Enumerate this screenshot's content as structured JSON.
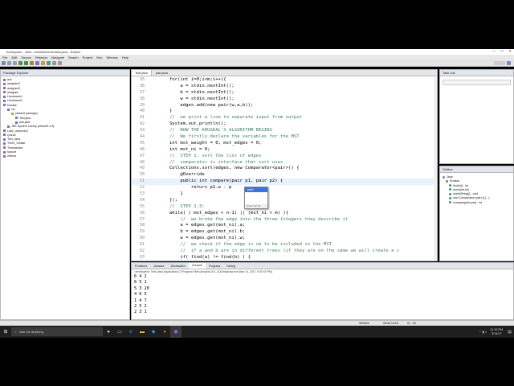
{
  "window": {
    "title": "workspace - Java - kruskal/src/kruskal.java - Eclipse"
  },
  "menu": [
    "File",
    "Edit",
    "Source",
    "Refactor",
    "Navigate",
    "Search",
    "Project",
    "Run",
    "Window",
    "Help"
  ],
  "package_explorer": {
    "title": "Package Explorer",
    "items": [
      {
        "label": "ack",
        "indent": 0
      },
      {
        "label": "anagram2",
        "indent": 0
      },
      {
        "label": "anagram3",
        "indent": 0
      },
      {
        "label": "anagram",
        "indent": 0
      },
      {
        "label": "Homework1",
        "indent": 0
      },
      {
        "label": "Homework2",
        "indent": 0
      },
      {
        "label": "kruskal",
        "indent": 0
      },
      {
        "label": "src",
        "indent": 1
      },
      {
        "label": "(default package)",
        "indent": 2
      },
      {
        "label": "Test.java",
        "indent": 3
      },
      {
        "label": "pair.java",
        "indent": 3
      },
      {
        "label": "JRE System Library [JavaSE-1.8]",
        "indent": 1
      },
      {
        "label": "Lab2_observer2",
        "indent": 0
      },
      {
        "label": "Queue",
        "indent": 0
      },
      {
        "label": "Test_Java",
        "indent": 0
      },
      {
        "label": "Three_Similar",
        "indent": 0
      },
      {
        "label": "Threadmark",
        "indent": 0
      },
      {
        "label": "topsort",
        "indent": 0
      },
      {
        "label": "whinos",
        "indent": 0
      }
    ]
  },
  "editor": {
    "tabs": [
      "Test.java",
      "pair.java"
    ],
    "lines": [
      {
        "n": "35",
        "text": "        for(int i=0;i<m;i++){",
        "kind": "code"
      },
      {
        "n": "36",
        "text": "            a = stdin.nextInt();",
        "kind": "code"
      },
      {
        "n": "37",
        "text": "            b = stdin.nextInt();",
        "kind": "code"
      },
      {
        "n": "38",
        "text": "            w = stdin.nextInt();",
        "kind": "code"
      },
      {
        "n": "39",
        "text": "            edges.add(new pair(w,a,b));",
        "kind": "code"
      },
      {
        "n": "40",
        "text": "        }",
        "kind": "code"
      },
      {
        "n": "41",
        "text": "        //  we print a line to separate input from output",
        "kind": "comment"
      },
      {
        "n": "42",
        "text": "        System.out.println();",
        "kind": "code"
      },
      {
        "n": "43",
        "text": "        //  NOW THE KRUSKAL'S ALGORITHM BEGINS",
        "kind": "comment"
      },
      {
        "n": "44",
        "text": "        //  We firstly declare the variables for the MST",
        "kind": "comment"
      },
      {
        "n": "45",
        "text": "        int mst_weight = 0, mst_edges = 0;",
        "kind": "code"
      },
      {
        "n": "46",
        "text": "        int mst_ni = 0;",
        "kind": "code"
      },
      {
        "n": "47",
        "text": "        //  STEP 1: sort the list of edges",
        "kind": "comment"
      },
      {
        "n": "48",
        "text": "        //  comparator is interface that sort uses",
        "kind": "comment"
      },
      {
        "n": "49",
        "text": "        Collections.sort(edges, new Comparator<pair>() {",
        "kind": "code"
      },
      {
        "n": "50",
        "text": "            @Override",
        "kind": "code"
      },
      {
        "n": "51",
        "text": "            public int compare(pair p1, pair p2) {",
        "kind": "hl"
      },
      {
        "n": "52",
        "text": "                return p1.w - p",
        "kind": "code"
      },
      {
        "n": "53",
        "text": "            }",
        "kind": "code"
      },
      {
        "n": "54",
        "text": "        });",
        "kind": "code"
      },
      {
        "n": "55",
        "text": "        //  STEP 2-3:",
        "kind": "comment"
      },
      {
        "n": "56",
        "text": "        while( ( mst_edges < n-1) || (mst_ni < m) ){",
        "kind": "code"
      },
      {
        "n": "57",
        "text": "            //  we broke the edge into the three integers they describe it",
        "kind": "comment"
      },
      {
        "n": "58",
        "text": "            a = edges.get(mst_ni).a;",
        "kind": "code"
      },
      {
        "n": "59",
        "text": "            b = edges.get(mst_ni).b;",
        "kind": "code"
      },
      {
        "n": "60",
        "text": "            w = edges.get(mst_ni).w;",
        "kind": "code"
      },
      {
        "n": "61",
        "text": "            //  we check if the edge is ok to be included in the MST",
        "kind": "comment"
      },
      {
        "n": "62",
        "text": "            //  if a and b are in different trees (if they are on the same we will create a c",
        "kind": "comment"
      },
      {
        "n": "63",
        "text": "            if( find(a) != find(b) ) {",
        "kind": "code"
      }
    ]
  },
  "autocomplete": {
    "items": [
      "pair1",
      "Press 'F2' for"
    ]
  },
  "task_list": {
    "title": "Task List"
  },
  "outline": {
    "title": "Outline",
    "items": [
      "Java",
      "Kruskal",
      "find(int) : int",
      "union(int,int)",
      "main(String[]) : void",
      "new Comparator<pair>() {...}",
      "compare(pair,pair) : int"
    ]
  },
  "console": {
    "tabs": [
      "Problems",
      "Javadoc",
      "Declaration",
      "Console",
      "Progress",
      "Debug"
    ],
    "header": "<terminated> Test [Java Application] C:\\Program Files\\Java\\jre1.8.0_111\\bin\\javaw.exe (Mar 14, 2017, 9:00:00 PM)",
    "lines": [
      "6 4 2",
      "6 5 1",
      "5 3 20",
      "4 6 5",
      "1 4 7",
      "2 5 2",
      "2 3 1"
    ]
  },
  "statusbar": {
    "mode": "Writable",
    "insert": "Smart Insert",
    "position": "51 : 46"
  },
  "taskbar": {
    "search": "Ask me anything",
    "time": "11:15 PM",
    "date": "3/14/17"
  }
}
